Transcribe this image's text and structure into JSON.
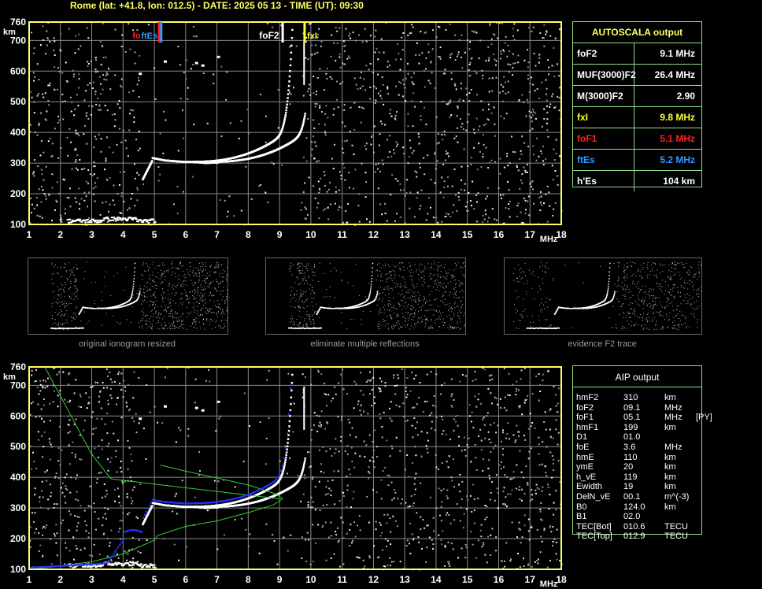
{
  "header": {
    "title": "Rome (lat: +41.8, lon: 012.5) - DATE: 2025 05 13 - TIME (UT): 09:30"
  },
  "axes": {
    "y_unit": "km",
    "x_unit": "MHz",
    "y_ticks": [
      "760",
      "700",
      "600",
      "500",
      "400",
      "300",
      "200",
      "100"
    ],
    "x_ticks": [
      "1",
      "2",
      "3",
      "4",
      "5",
      "6",
      "7",
      "8",
      "9",
      "10",
      "11",
      "12",
      "13",
      "14",
      "15",
      "16",
      "17",
      "18"
    ]
  },
  "top_markers": {
    "fxi_label": "fxI",
    "foF2_label": "foF2",
    "fxI_label": "fxI",
    "ftEs_label": "ftEs",
    "foF1_label": "fo"
  },
  "autoscala": {
    "title": "AUTOSCALA output",
    "rows": [
      {
        "key": "foF2",
        "value": "9.1  MHz",
        "color": "#ffffff"
      },
      {
        "key": "MUF(3000)F2",
        "value": "26.4  MHz",
        "color": "#ffffff"
      },
      {
        "key": "M(3000)F2",
        "value": "2.90",
        "color": "#ffffff"
      },
      {
        "key": "fxI",
        "value": "9.8  MHz",
        "color": "#ffff33"
      },
      {
        "key": "foF1",
        "value": "5.1  MHz",
        "color": "#ff2020"
      },
      {
        "key": "ftEs",
        "value": "5.2  MHz",
        "color": "#3399ff"
      },
      {
        "key": "h'Es",
        "value": "104     km",
        "color": "#ffffff"
      }
    ]
  },
  "thumbnails": [
    {
      "caption": "original ionogram resized"
    },
    {
      "caption": "eliminate multiple reflections"
    },
    {
      "caption": "evidence F2 trace"
    }
  ],
  "aip": {
    "title": "AIP output",
    "rows": [
      [
        "hmF2",
        "310",
        "km",
        ""
      ],
      [
        "foF2",
        "09.1",
        "MHz",
        ""
      ],
      [
        "foF1",
        "05.1",
        "MHz",
        "[PY]"
      ],
      [
        "hmF1",
        "199",
        "km",
        ""
      ],
      [
        "D1",
        "01.0",
        "",
        ""
      ],
      [
        "foE",
        "3.6",
        "MHz",
        ""
      ],
      [
        "hmE",
        "110",
        "km",
        ""
      ],
      [
        "ymE",
        "20",
        "km",
        ""
      ],
      [
        "h_vE",
        "119",
        "km",
        ""
      ],
      [
        "Ewidth",
        "19",
        "km",
        ""
      ],
      [
        "DelN_vE",
        "00.1",
        "m^(-3)",
        ""
      ],
      [
        "B0",
        "124.0",
        "km",
        ""
      ],
      [
        "B1",
        "02.0",
        "",
        ""
      ],
      [
        "TEC[Bot]",
        "010.6",
        "TECU",
        ""
      ],
      [
        "TEC[Top]",
        "012.9",
        "TECU",
        ""
      ]
    ]
  },
  "colors": {
    "grid": "#8a8a8a",
    "frame": "#ffff66",
    "panel_border": "#8fe08f",
    "profile": "#33cc33",
    "aip_points": "#2233ff"
  }
}
